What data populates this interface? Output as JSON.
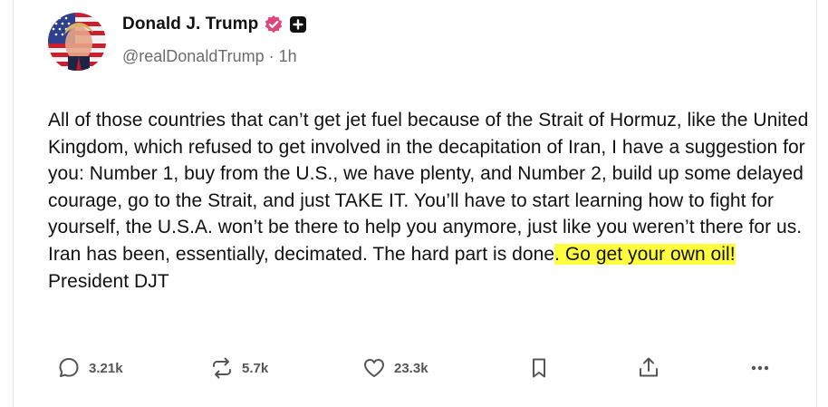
{
  "post": {
    "author": {
      "display_name": "Donald J. Trump",
      "handle": "@realDonaldTrump",
      "separator": "·",
      "time": "1h",
      "badge_color": "#e0457b"
    },
    "text": {
      "part1": "All of those countries that can’t get jet fuel because of the Strait of Hormuz, like the United Kingdom, which refused to get involved in the decapitation of Iran, I have a suggestion for you: Number 1, buy from the U.S., we have plenty, and Number 2, build up some delayed courage, go to the Strait, and just TAKE IT. You’ll have to start learning how to fight for yourself, the U.S.A. won’t be there to help you anymore, just like you weren’t there for us. Iran has been, essentially, decimated. The hard part is done",
      "highlighted": ". Go get your own oil!",
      "part2": " President DJT",
      "highlight_color": "#ffff3d"
    },
    "actions": {
      "replies": "3.21k",
      "retruths": "5.7k",
      "likes": "23.3k"
    }
  }
}
